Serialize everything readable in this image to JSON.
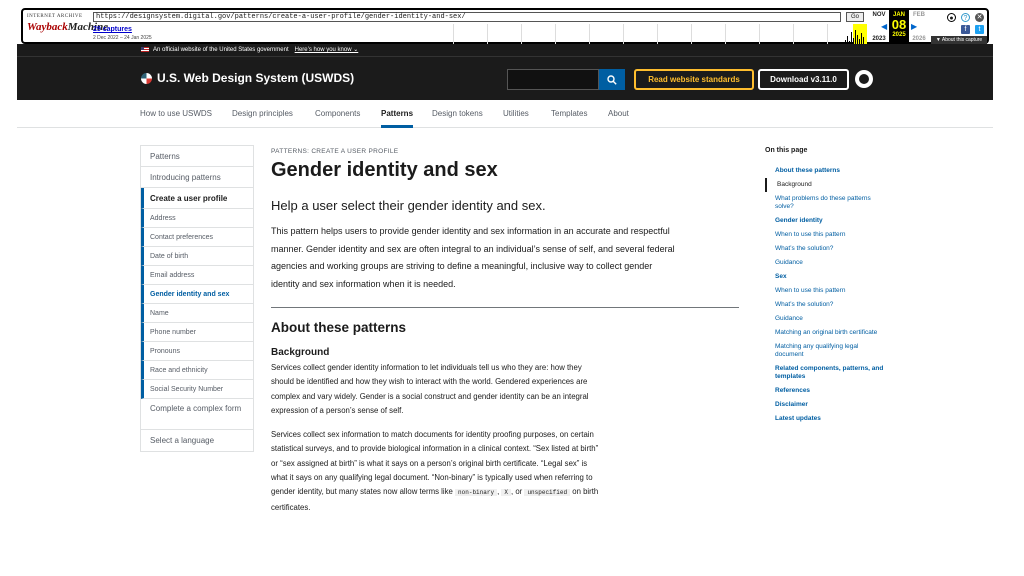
{
  "wayback": {
    "logo_top": "INTERNET ARCHIVE",
    "logo_main_a": "Wayback",
    "logo_main_b": "Machine",
    "url": "https://designsystem.digital.gov/patterns/create-a-user-profile/gender-identity-and-sex/",
    "go": "Go",
    "captures": "29 captures",
    "range": "2 Dec 2022 – 24 Jan 2025",
    "prev_month": "NOV",
    "cur_month": "JAN",
    "next_month": "FEB",
    "day": "08",
    "prev_year": "2023",
    "cur_year": "2025",
    "next_year": "2026",
    "about": "▼ About this capture"
  },
  "gov_banner": {
    "text": "An official website of the United States government",
    "link": "Here’s how you know ⌄"
  },
  "header": {
    "title": "U.S. Web Design System (USWDS)",
    "btn_standards": "Read website standards",
    "btn_download": "Download v3.11.0"
  },
  "nav": [
    "How to use USWDS",
    "Design principles",
    "Components",
    "Patterns",
    "Design tokens",
    "Utilities",
    "Templates",
    "About"
  ],
  "sidenav": {
    "top": [
      "Patterns",
      "Introducing patterns"
    ],
    "current": "Create a user profile",
    "sub": [
      "Address",
      "Contact preferences",
      "Date of birth",
      "Email address",
      "Gender identity and sex",
      "Name",
      "Phone number",
      "Pronouns",
      "Race and ethnicity",
      "Social Security Number"
    ],
    "bottom": [
      "Complete a complex form",
      "Select a language"
    ]
  },
  "main": {
    "crumb": "PATTERNS: CREATE A USER PROFILE",
    "title": "Gender identity and sex",
    "lead": "Help a user select their gender identity and sex.",
    "intro": "This pattern helps users to provide gender identity and sex information in an accurate and respectful manner. Gender identity and sex are often integral to an individual’s sense of self, and several federal agencies and working groups are striving to define a meaningful, inclusive way to collect gender identity and sex information when it is needed.",
    "h2": "About these patterns",
    "h3": "Background",
    "p1": "Services collect gender identity information to let individuals tell us who they are: how they should be identified and how they wish to interact with the world. Gendered experiences are complex and vary widely. Gender is a social construct and gender identity can be an integral expression of a person’s sense of self.",
    "p2a": "Services collect sex information to match documents for identity proofing purposes, on certain statistical surveys, and to provide biological information in a clinical context. “Sex listed at birth” or “sex assigned at birth” is what it says on a person’s original birth certificate. “Legal sex” is what it says on any qualifying legal document. “Non-binary” is typically used when referring to gender identity, but many states now allow terms like",
    "code1": "non-binary",
    "sep1": ",",
    "code2": "X",
    "sep2": ", or",
    "code3": "unspecified",
    "p2b": "on birth certificates."
  },
  "on_this_page": {
    "heading": "On this page",
    "items": [
      "About these patterns",
      "Background",
      "What problems do these patterns solve?",
      "Gender identity",
      "When to use this pattern",
      "What’s the solution?",
      "Guidance",
      "Sex",
      "When to use this pattern",
      "What’s the solution?",
      "Guidance",
      "Matching an original birth certificate",
      "Matching any qualifying legal document",
      "Related components, patterns, and templates",
      "References",
      "Disclaimer",
      "Latest updates"
    ]
  },
  "colors": {
    "primary": "#005ea2",
    "header_bg": "#1b1b1b",
    "accent_warm": "#ffbe2e"
  }
}
